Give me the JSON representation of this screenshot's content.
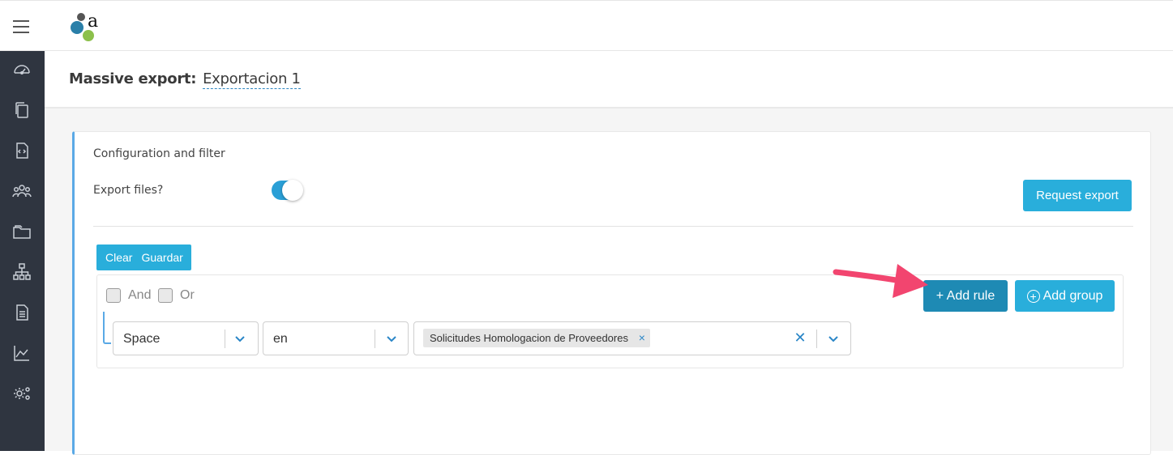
{
  "header": {
    "menu_icon": "hamburger-menu-icon",
    "logo": "app-logo"
  },
  "sidebar": {
    "items": [
      {
        "icon": "dashboard-gauge-icon"
      },
      {
        "icon": "copy-documents-icon"
      },
      {
        "icon": "code-file-icon"
      },
      {
        "icon": "users-group-icon"
      },
      {
        "icon": "folder-icon"
      },
      {
        "icon": "org-hierarchy-icon"
      },
      {
        "icon": "document-list-icon"
      },
      {
        "icon": "line-chart-icon"
      },
      {
        "icon": "settings-gears-icon"
      }
    ]
  },
  "page": {
    "title_label": "Massive export:",
    "title_value": "Exportacion 1"
  },
  "panel": {
    "title": "Configuration and filter",
    "export_files_label": "Export files?",
    "export_files_enabled": true,
    "request_export_label": "Request export"
  },
  "query_builder": {
    "clear_label": "Clear",
    "save_label": "Guardar",
    "and_label": "And",
    "or_label": "Or",
    "add_rule_label": "+ Add rule",
    "add_group_label": "Add group",
    "rule": {
      "field": "Space",
      "operator": "en",
      "values": [
        "Solicitudes Homologacion de Proveedores"
      ]
    }
  },
  "colors": {
    "accent": "#29aedb",
    "accent_dark": "#1e8ab4",
    "sidebar_bg": "#2f3540",
    "annotation_arrow": "#f2456f"
  }
}
